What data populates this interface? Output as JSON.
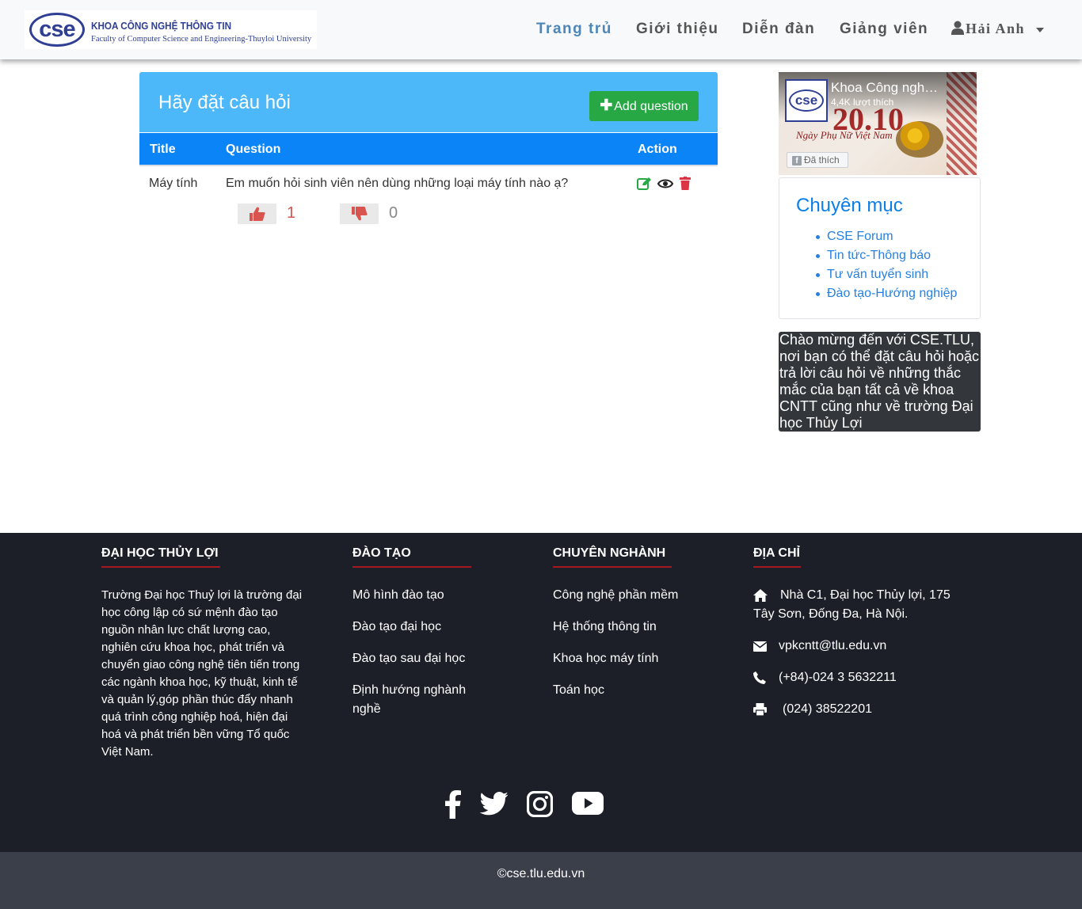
{
  "header": {
    "logo": {
      "mark": "cse",
      "title": "KHOA CÔNG NGHỆ THÔNG TIN",
      "subtitle": "Faculty of Computer Science and Engineering-Thuyloi University"
    },
    "nav": [
      "Trang trủ",
      "Giới thiệu",
      "Diễn đàn",
      "Giảng viên"
    ],
    "user": "Hải Anh"
  },
  "questions": {
    "panel_title": "Hãy đặt câu hỏi",
    "add_button": "Add question",
    "columns": [
      "Title",
      "Question",
      "Action"
    ],
    "rows": [
      {
        "title": "Máy tính",
        "question": "Em muốn hỏi sinh viên nên dùng những loại máy tính nào ạ?",
        "likes": "1",
        "dislikes": "0"
      }
    ]
  },
  "sidebar": {
    "fb": {
      "name": "Khoa Công ngh…",
      "likes": "4,4K lượt thích",
      "liked_button": "Đã thích",
      "big_text": "20.10",
      "script": "Ngày Phụ Nữ Việt Nam"
    },
    "categories_title": "Chuyên mục",
    "categories": [
      "CSE Forum",
      "Tin tức-Thông báo",
      "Tư vấn tuyển sinh",
      "Đào tạo-Hướng nghiệp"
    ],
    "welcome": "Chào mừng đến với CSE.TLU, nơi bạn có thể đặt câu hỏi hoặc trả lời câu hỏi về những thắc mắc của bạn tất cả về khoa CNTT cũng như về trường Đại học Thủy Lợi"
  },
  "footer": {
    "headings": [
      "ĐẠI HỌC THỦY LỢI",
      "ĐÀO TẠO",
      "CHUYÊN NGHÀNH",
      "ĐỊA CHỈ"
    ],
    "about": "Trường Đại học Thuỷ lợi là trường đại học công lập có sứ mệnh đào tạo nguồn nhân lực chất lượng cao, nghiên cứu khoa học, phát triển và chuyển giao công nghệ tiên tiến trong các ngành khoa học, kỹ thuật, kinh tế và quản lý,góp phần thúc đẩy nhanh quá trình công nghiệp hoá, hiện đại hoá và phát triển bền vững Tổ quốc Việt Nam.",
    "training": [
      "Mô hình đào tạo",
      "Đào tạo đại học",
      "Đào tạo sau đại học",
      "Định hướng nghành nghề"
    ],
    "majors": [
      "Công nghệ phần mềm",
      "Hệ thống thông tin",
      "Khoa học máy tính",
      "Toán học"
    ],
    "address": "Nhà C1, Đại học Thủy lợi, 175 Tây Sơn, Đống Đa, Hà Nội.",
    "email": "vpkcntt@tlu.edu.vn",
    "phone": "(+84)-024 3 5632211",
    "fax": "(024) 38522201",
    "copyright": "©cse.tlu.edu.vn"
  },
  "colors": {
    "accent_blue": "#4db8f9",
    "table_blue": "#0b84f7",
    "add_green": "#28a745",
    "vote_red": "#d9534f",
    "footer_bg": "#1d1f28",
    "footer_line": "#a3191f"
  }
}
